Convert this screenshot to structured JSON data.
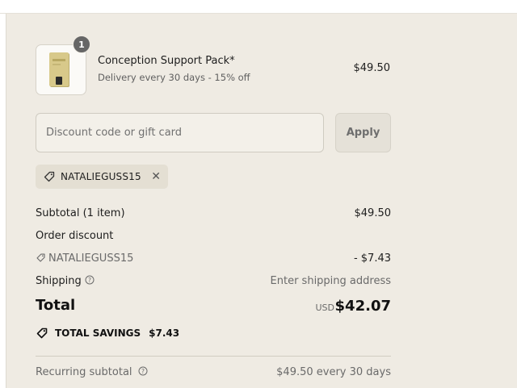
{
  "line_item": {
    "quantity": "1",
    "name": "Conception Support Pack*",
    "subtitle": "Delivery every 30 days - 15% off",
    "price": "$49.50"
  },
  "discount": {
    "placeholder": "Discount code or gift card",
    "value": "",
    "apply_label": "Apply"
  },
  "applied_code": {
    "code": "NATALIEGUSS15",
    "remove_symbol": "✕"
  },
  "summary": {
    "subtotal_label": "Subtotal (1 item)",
    "subtotal_value": "$49.50",
    "order_discount_label": "Order discount",
    "discount_code": "NATALIEGUSS15",
    "discount_value": "- $7.43",
    "shipping_label": "Shipping",
    "shipping_value": "Enter shipping address",
    "total_label": "Total",
    "total_currency": "USD",
    "total_value": "$42.07",
    "savings_label": "TOTAL SAVINGS",
    "savings_value": "$7.43",
    "recurring_label": "Recurring subtotal",
    "recurring_value": "$49.50 every 30 days"
  },
  "icons": {
    "tag": "tag-icon",
    "info": "info-icon",
    "remove": "close-icon"
  },
  "colors": {
    "background": "#efebe3",
    "chip": "#e4dfd3",
    "badge": "#666666",
    "text": "#1d1d1d",
    "muted": "#6a6a6a"
  }
}
